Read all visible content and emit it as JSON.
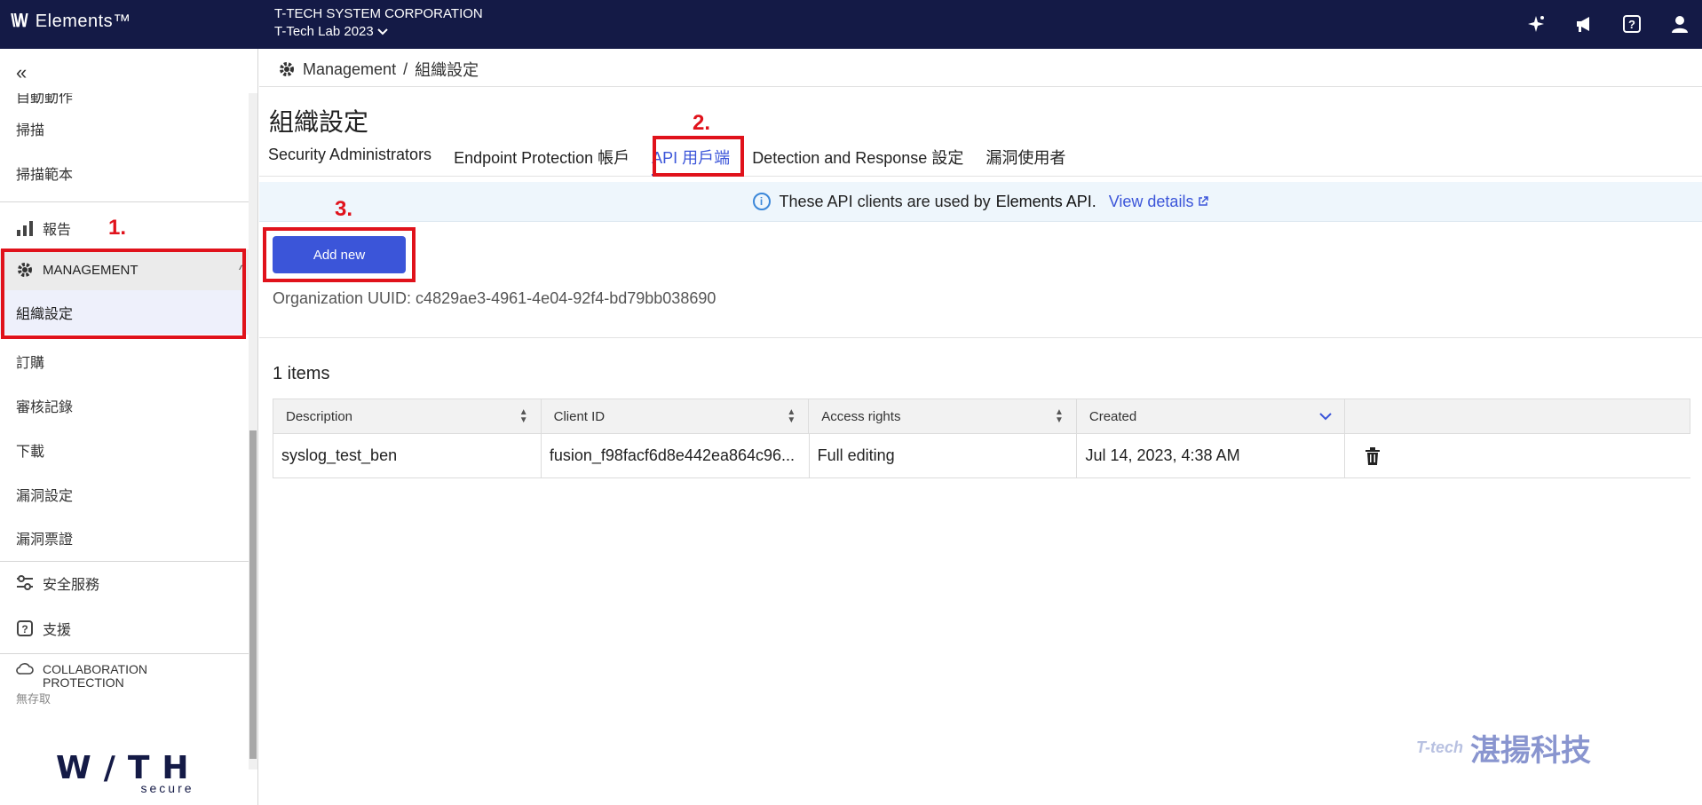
{
  "topbar": {
    "brand": "Elements™",
    "org_name": "T-TECH SYSTEM CORPORATION",
    "org_sub": "T-Tech Lab 2023",
    "icons": [
      "sparkle-icon",
      "megaphone-icon",
      "help-icon",
      "user-icon"
    ]
  },
  "sidebar": {
    "items_top": [
      "自動動作",
      "掃描",
      "掃描範本"
    ],
    "report_label": "報告",
    "management_label": "MANAGEMENT",
    "management_selected": "組織設定",
    "management_items": [
      "訂購",
      "審核記錄",
      "下載",
      "漏洞設定",
      "漏洞票證"
    ],
    "security_services": "安全服務",
    "support": "支援",
    "collab_line1": "COLLABORATION",
    "collab_line2": "PROTECTION",
    "collab_status": "無存取",
    "footer_brand": "W/TH",
    "footer_sub": "secure"
  },
  "breadcrumb": {
    "root": "Management",
    "sep": "/",
    "current": "組織設定"
  },
  "page": {
    "title": "組織設定",
    "tabs": [
      "Security Administrators",
      "Endpoint Protection 帳戶",
      "API 用戶端",
      "Detection and Response 設定",
      "漏洞使用者"
    ],
    "active_tab": 2
  },
  "banner": {
    "text": "These API clients are used by",
    "bold": "Elements API.",
    "link": "View details"
  },
  "actions": {
    "add_new": "Add new"
  },
  "uuid_text": "Organization UUID: c4829ae3-4961-4e04-92f4-bd79bb038690",
  "items_count": "1 items",
  "table": {
    "columns": [
      "Description",
      "Client ID",
      "Access rights",
      "Created",
      ""
    ],
    "rows": [
      {
        "description": "syslog_test_ben",
        "client_id": "fusion_f98facf6d8e442ea864c96...",
        "access": "Full editing",
        "created": "Jul 14, 2023, 4:38 AM"
      }
    ]
  },
  "annotations": [
    "1.",
    "2.",
    "3."
  ],
  "watermark": {
    "logo": "T-tech",
    "text": "湛揚科技"
  },
  "colors": {
    "topbar": "#141a46",
    "accent": "#3b55d9",
    "annotation": "#e0121b"
  }
}
